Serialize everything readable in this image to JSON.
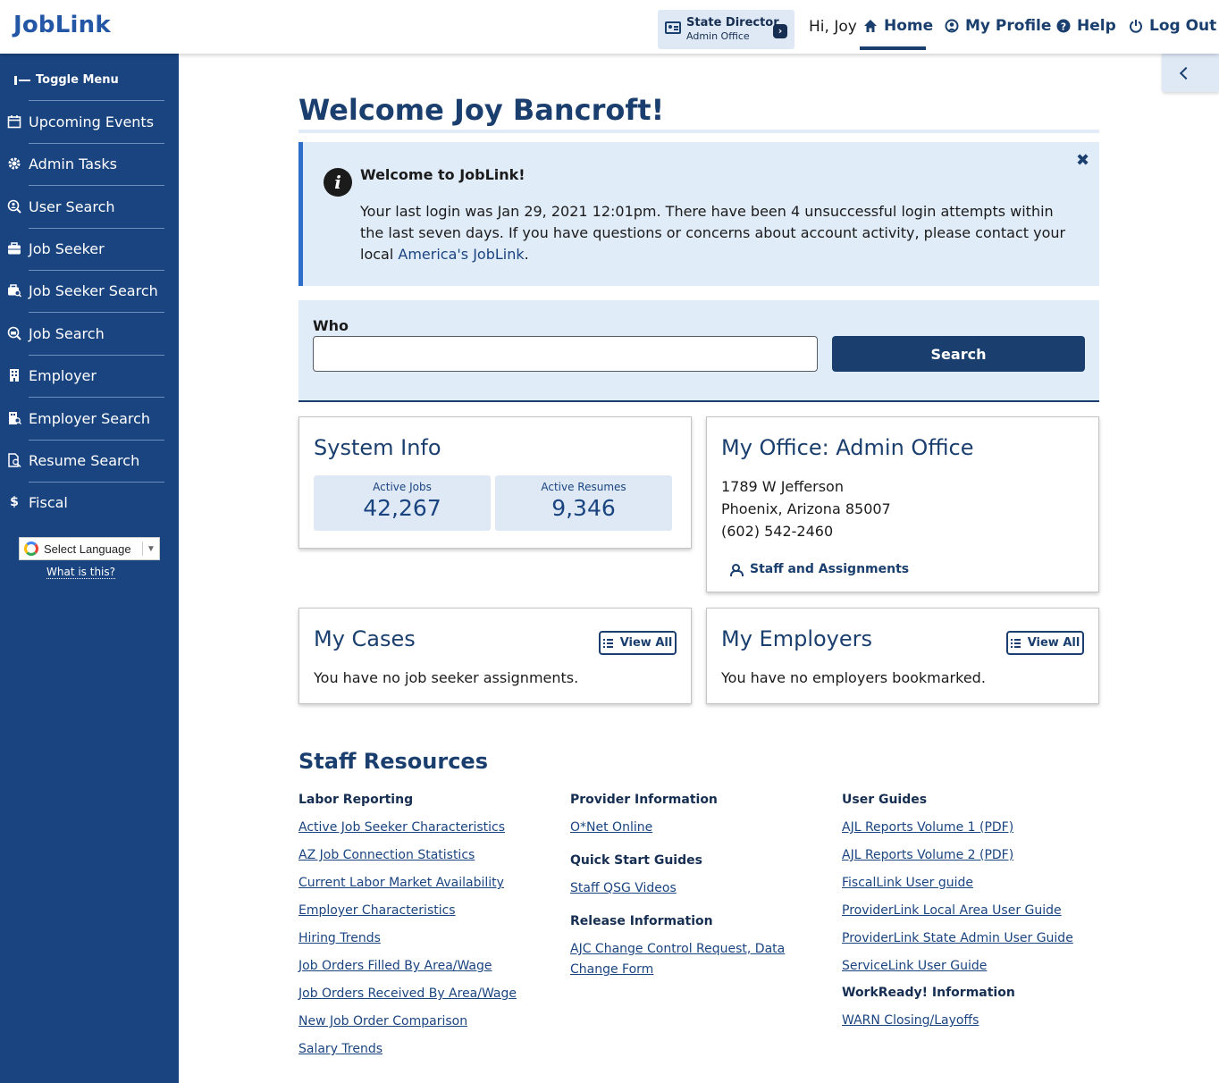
{
  "header": {
    "logo": "JobLink",
    "role_title": "State Director",
    "role_sub": "Admin Office",
    "greeting": "Hi, Joy",
    "nav": [
      {
        "label": "Home",
        "icon": "home-icon"
      },
      {
        "label": "My Profile",
        "icon": "user-circle-icon"
      },
      {
        "label": "Help",
        "icon": "question-circle-icon"
      },
      {
        "label": "Log Out",
        "icon": "power-icon"
      }
    ]
  },
  "sidebar": {
    "toggle_label": "Toggle Menu",
    "items": [
      {
        "label": "Upcoming Events",
        "icon": "calendar-icon"
      },
      {
        "label": "Admin Tasks",
        "icon": "gear-icon"
      },
      {
        "label": "User Search",
        "icon": "user-search-icon"
      },
      {
        "label": "Job Seeker",
        "icon": "briefcase-icon"
      },
      {
        "label": "Job Seeker Search",
        "icon": "briefcase-search-icon"
      },
      {
        "label": "Job Search",
        "icon": "search-icon"
      },
      {
        "label": "Employer",
        "icon": "building-icon"
      },
      {
        "label": "Employer Search",
        "icon": "building-search-icon"
      },
      {
        "label": "Resume Search",
        "icon": "document-search-icon"
      },
      {
        "label": "Fiscal",
        "icon": "dollar-icon"
      }
    ],
    "language_label": "Select Language",
    "what_is_this": "What is this?"
  },
  "main": {
    "welcome": "Welcome Joy Bancroft!",
    "alert": {
      "heading": "Welcome to JobLink!",
      "body": "Your last login was Jan 29, 2021 12:01pm. There have been 4 unsuccessful login attempts within the last seven days. If you have questions or concerns about account activity, please contact your local ",
      "link": "America's JobLink",
      "end": "."
    },
    "search": {
      "label": "Who",
      "value": "",
      "button": "Search"
    },
    "system_info": {
      "title": "System Info",
      "stats": [
        {
          "label": "Active Jobs",
          "value": "42,267"
        },
        {
          "label": "Active Resumes",
          "value": "9,346"
        }
      ]
    },
    "office": {
      "title": "My Office: Admin Office",
      "address1": "1789 W Jefferson",
      "address2": "Phoenix, Arizona 85007",
      "phone": "(602) 542-2460",
      "staff_link": "Staff and Assignments"
    },
    "cases": {
      "title": "My Cases",
      "view_all": "View All",
      "text": "You have no job seeker assignments."
    },
    "employers": {
      "title": "My Employers",
      "view_all": "View All",
      "text": "You have no employers bookmarked."
    }
  },
  "resources": {
    "title": "Staff Resources",
    "columns": [
      {
        "groups": [
          {
            "heading": "Labor Reporting",
            "links": [
              "Active Job Seeker Characteristics",
              "AZ Job Connection Statistics",
              "Current Labor Market Availability",
              "Employer Characteristics",
              "Hiring Trends",
              "Job Orders Filled By Area/Wage",
              "Job Orders Received By Area/Wage",
              "New Job Order Comparison",
              "Salary Trends"
            ]
          }
        ]
      },
      {
        "groups": [
          {
            "heading": "Provider Information",
            "links": [
              "O*Net Online"
            ]
          },
          {
            "heading": "Quick Start Guides",
            "links": [
              "Staff QSG Videos"
            ]
          },
          {
            "heading": "Release Information",
            "links": [
              "AJC Change Control Request, Data Change Form"
            ]
          }
        ]
      },
      {
        "groups": [
          {
            "heading": "User Guides",
            "links": [
              "AJL Reports Volume 1 (PDF)",
              "AJL Reports Volume 2 (PDF)",
              "FiscalLink User guide",
              "ProviderLink Local Area User Guide",
              "ProviderLink State Admin User Guide",
              "ServiceLink User Guide"
            ]
          },
          {
            "heading": "WorkReady! Information",
            "links": [
              "WARN Closing/Layoffs"
            ]
          }
        ]
      }
    ]
  }
}
